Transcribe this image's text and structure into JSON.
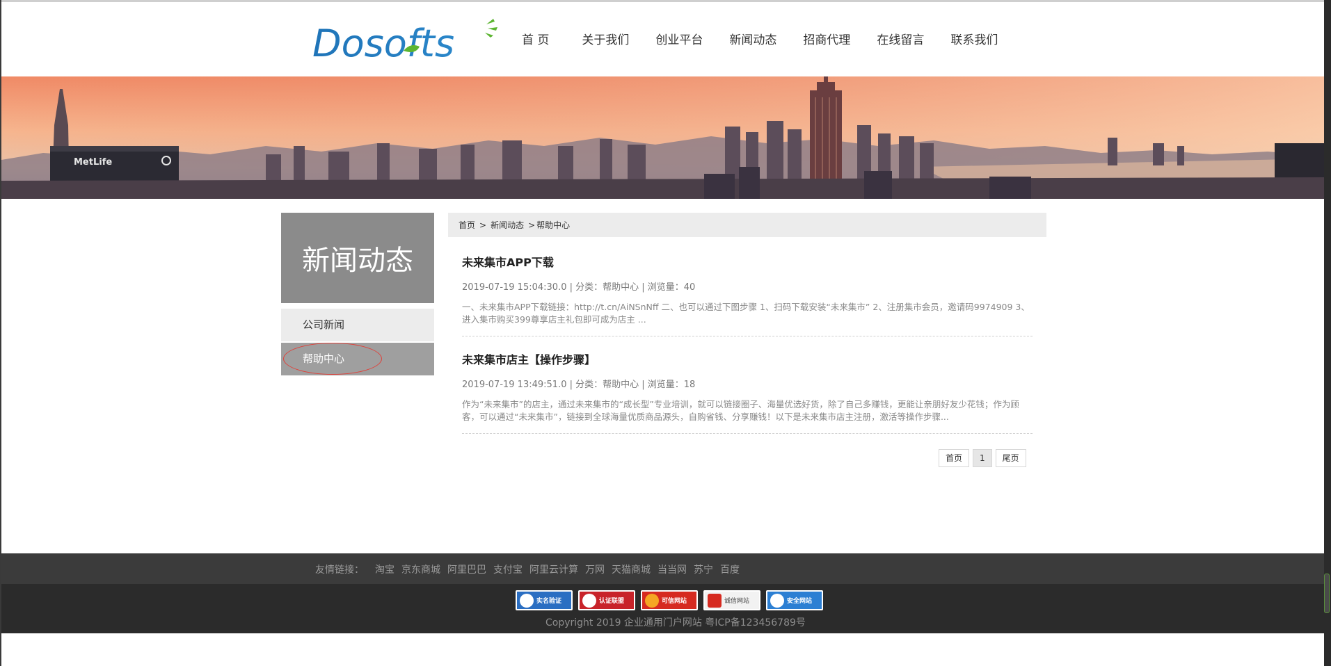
{
  "logo": {
    "text": "Dosofts"
  },
  "nav": [
    {
      "label": "首 页"
    },
    {
      "label": "关于我们"
    },
    {
      "label": "创业平台"
    },
    {
      "label": "新闻动态"
    },
    {
      "label": "招商代理"
    },
    {
      "label": "在线留言"
    },
    {
      "label": "联系我们"
    }
  ],
  "banner": {
    "building_sign": "MetLife"
  },
  "sidebar": {
    "title": "新闻动态",
    "items": [
      {
        "label": "公司新闻"
      },
      {
        "label": "帮助中心",
        "active": true
      }
    ]
  },
  "breadcrumb": {
    "home": "首页",
    "sep": ">",
    "section": "新闻动态",
    "current": "帮助中心"
  },
  "articles": [
    {
      "title": "未来集市APP下载",
      "meta": "2019-07-19 15:04:30.0 | 分类：帮助中心 | 浏览量：40",
      "summary": "一、未来集市APP下载链接：http://t.cn/AiNSnNff 二、也可以通过下图步骤 1、扫码下载安装“未来集市” 2、注册集市会员，邀请码9974909 3、进入集市购买399尊享店主礼包即可成为店主 ..."
    },
    {
      "title": "未来集市店主【操作步骤】",
      "meta": "2019-07-19 13:49:51.0 | 分类：帮助中心 | 浏览量：18",
      "summary": "作为“未来集市”的店主，通过未来集市的“成长型”专业培训，就可以链接圈子、海量优选好货，除了自己多赚钱，更能让亲朋好友少花钱；作为顾客，可以通过“未来集市”，链接到全球海量优质商品源头，自购省钱、分享赚钱！以下是未来集市店主注册，激活等操作步骤..."
    }
  ],
  "pager": {
    "first": "首页",
    "page": "1",
    "last": "尾页"
  },
  "footer": {
    "links_label": "友情链接：",
    "links": [
      "淘宝",
      "京东商城",
      "阿里巴巴",
      "支付宝",
      "阿里云计算",
      "万网",
      "天猫商城",
      "当当网",
      "苏宁",
      "百度"
    ],
    "badges": [
      "实名验证",
      "认证联盟",
      "可信网站",
      "诚信网站",
      "安全网站"
    ],
    "copyright": "Copyright 2019 企业通用门户网站 粤ICP备123456789号"
  },
  "colors": {
    "sidebar_title_bg": "#8b8b8b",
    "sidebar_active_bg": "#9f9f9f",
    "footer_links_bg": "#3b3b3b",
    "footer_bottom_bg": "#2b2b2b",
    "logo_blue": "#1f74b8",
    "logo_green": "#5cb531",
    "highlight_circle": "#e0413a"
  }
}
